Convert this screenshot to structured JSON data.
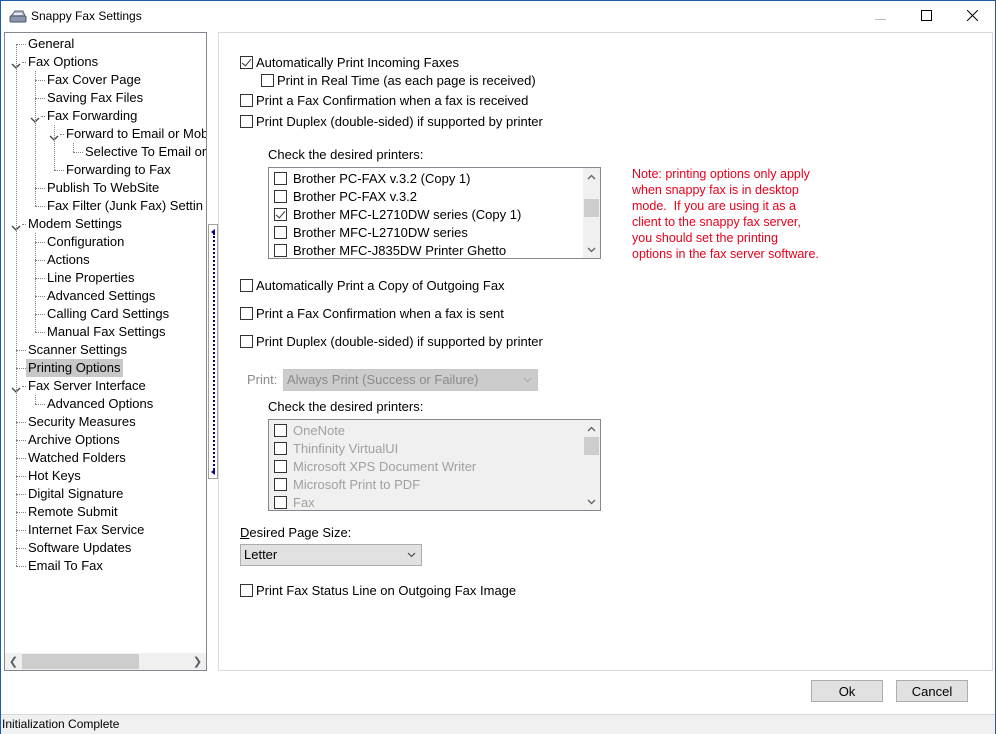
{
  "window": {
    "title": "Snappy Fax Settings",
    "controls": {
      "minimize": "minimize",
      "maximize": "maximize",
      "close": "close"
    }
  },
  "tree": {
    "items": [
      {
        "label": "General",
        "level": 0,
        "expandable": false
      },
      {
        "label": "Fax Options",
        "level": 0,
        "expandable": true
      },
      {
        "label": "Fax Cover Page",
        "level": 1,
        "expandable": false
      },
      {
        "label": "Saving Fax Files",
        "level": 1,
        "expandable": false
      },
      {
        "label": "Fax Forwarding",
        "level": 1,
        "expandable": true
      },
      {
        "label": "Forward to Email or Mob",
        "level": 2,
        "expandable": true
      },
      {
        "label": "Selective To Email or",
        "level": 3,
        "expandable": false
      },
      {
        "label": "Forwarding to Fax",
        "level": 2,
        "expandable": false
      },
      {
        "label": "Publish To WebSite",
        "level": 1,
        "expandable": false
      },
      {
        "label": "Fax Filter (Junk Fax) Settin",
        "level": 1,
        "expandable": false
      },
      {
        "label": "Modem Settings",
        "level": 0,
        "expandable": true
      },
      {
        "label": "Configuration",
        "level": 1,
        "expandable": false
      },
      {
        "label": "Actions",
        "level": 1,
        "expandable": false
      },
      {
        "label": "Line Properties",
        "level": 1,
        "expandable": false
      },
      {
        "label": "Advanced Settings",
        "level": 1,
        "expandable": false
      },
      {
        "label": "Calling Card Settings",
        "level": 1,
        "expandable": false
      },
      {
        "label": "Manual Fax Settings",
        "level": 1,
        "expandable": false
      },
      {
        "label": "Scanner Settings",
        "level": 0,
        "expandable": false
      },
      {
        "label": "Printing Options",
        "level": 0,
        "expandable": false,
        "selected": true
      },
      {
        "label": "Fax Server Interface",
        "level": 0,
        "expandable": true
      },
      {
        "label": "Advanced Options",
        "level": 1,
        "expandable": false
      },
      {
        "label": "Security Measures",
        "level": 0,
        "expandable": false
      },
      {
        "label": "Archive Options",
        "level": 0,
        "expandable": false
      },
      {
        "label": "Watched Folders",
        "level": 0,
        "expandable": false
      },
      {
        "label": "Hot Keys",
        "level": 0,
        "expandable": false
      },
      {
        "label": "Digital Signature",
        "level": 0,
        "expandable": false
      },
      {
        "label": "Remote Submit",
        "level": 0,
        "expandable": false
      },
      {
        "label": "Internet Fax Service",
        "level": 0,
        "expandable": false
      },
      {
        "label": "Software Updates",
        "level": 0,
        "expandable": false
      },
      {
        "label": "Email To Fax",
        "level": 0,
        "expandable": false
      }
    ]
  },
  "incoming": {
    "auto_print": {
      "label": "Automatically Print Incoming Faxes",
      "checked": true
    },
    "real_time": {
      "label": "Print in Real Time (as each page is received)",
      "checked": false
    },
    "confirmation": {
      "label": "Print a Fax Confirmation when a fax is received",
      "checked": false
    },
    "duplex": {
      "label": "Print Duplex (double-sided) if supported by printer",
      "checked": false
    },
    "printers_label": "Check the desired printers:",
    "printers": [
      {
        "name": "Brother PC-FAX v.3.2 (Copy 1)",
        "checked": false
      },
      {
        "name": "Brother PC-FAX v.3.2",
        "checked": false
      },
      {
        "name": "Brother MFC-L2710DW series (Copy 1)",
        "checked": true
      },
      {
        "name": "Brother MFC-L2710DW series",
        "checked": false
      },
      {
        "name": "Brother MFC-J835DW Printer Ghetto",
        "checked": false
      }
    ]
  },
  "note": "Note: printing options only apply\nwhen snappy fax is in desktop\nmode.  If you are using it as a\nclient to the snappy fax server,\nyou should set the printing\noptions in the fax server software.",
  "outgoing": {
    "auto_print": {
      "label": "Automatically Print a Copy of Outgoing Fax",
      "checked": false
    },
    "confirmation": {
      "label": "Print a Fax Confirmation when a fax is sent",
      "checked": false
    },
    "duplex": {
      "label": "Print Duplex (double-sided) if supported by printer",
      "checked": false
    },
    "print_label": "Print:",
    "print_mode": "Always Print (Success or Failure)",
    "printers_label": "Check the desired printers:",
    "printers": [
      {
        "name": "OneNote",
        "checked": false
      },
      {
        "name": "Thinfinity VirtualUI",
        "checked": false
      },
      {
        "name": "Microsoft XPS Document Writer",
        "checked": false
      },
      {
        "name": "Microsoft Print to PDF",
        "checked": false
      },
      {
        "name": "Fax",
        "checked": false
      }
    ]
  },
  "page_size": {
    "label": "Desired Page Size:",
    "value": "Letter"
  },
  "status_line": {
    "label": "Print Fax Status Line on Outgoing Fax Image",
    "checked": false
  },
  "buttons": {
    "ok": "Ok",
    "cancel": "Cancel"
  },
  "statusbar": {
    "text": "Initialization Complete"
  },
  "colors": {
    "note": "#e8001c",
    "selection": "#c8c8c8",
    "window_border": "#1e5aa8"
  }
}
